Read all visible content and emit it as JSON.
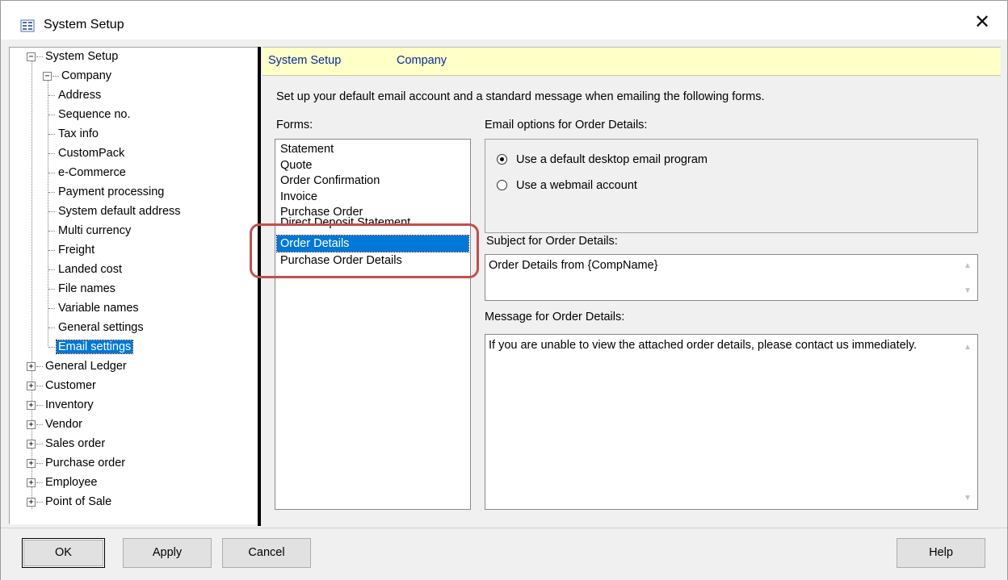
{
  "window": {
    "title": "System Setup",
    "close_symbol": "✕",
    "icon": "setup-app-icon"
  },
  "tree": {
    "root": "System Setup",
    "company": "Company",
    "company_children": [
      "Address",
      "Sequence no.",
      "Tax info",
      "CustomPack",
      "e-Commerce",
      "Payment processing",
      "System default address",
      "Multi currency",
      "Freight",
      "Landed cost",
      "File names",
      "Variable names",
      "General settings",
      "Email settings"
    ],
    "selected": "Email settings",
    "collapsed": [
      "General Ledger",
      "Customer",
      "Inventory",
      "Vendor",
      "Sales order",
      "Purchase order",
      "Employee",
      "Point of Sale"
    ],
    "expanded_glyph": "−",
    "collapsed_glyph": "+"
  },
  "breadcrumb": {
    "first": "System Setup",
    "second": "Company"
  },
  "intro": "Set up your default email account and a standard message when emailing the following forms.",
  "forms": {
    "label": "Forms:",
    "items": [
      "Statement",
      "Quote",
      "Order Confirmation",
      "Invoice",
      "Purchase Order",
      "Direct Deposit Statement",
      "Order Details",
      "Purchase Order Details"
    ],
    "selected": "Order Details"
  },
  "email_options": {
    "label": "Email options for Order Details:",
    "option1": "Use a default desktop email program",
    "option2": "Use a webmail account",
    "selected": "Use a default desktop email program"
  },
  "subject": {
    "label": "Subject for Order Details:",
    "value": "Order Details from {CompName}"
  },
  "message": {
    "label": "Message for Order Details:",
    "value": "If you are unable to view the attached order details, please contact us immediately."
  },
  "buttons": {
    "ok": "OK",
    "apply": "Apply",
    "cancel": "Cancel",
    "help": "Help"
  },
  "annotation_color": "#c0504d",
  "selection_color": "#0078d7"
}
